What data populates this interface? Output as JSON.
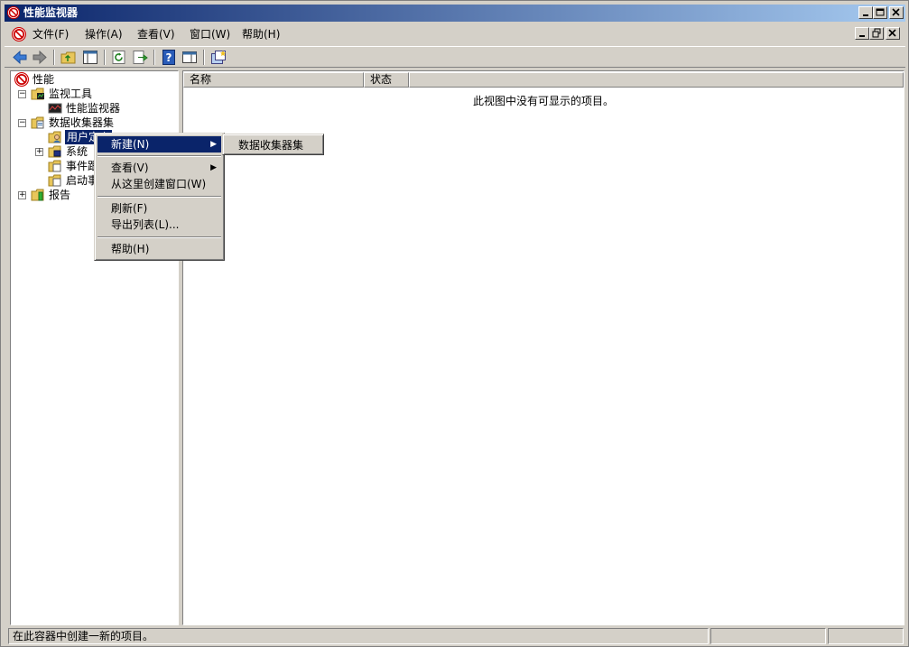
{
  "window": {
    "title": "性能监视器"
  },
  "menubar": {
    "items": [
      {
        "label": "文件(F)"
      },
      {
        "label": "操作(A)"
      },
      {
        "label": "查看(V)"
      },
      {
        "label": "窗口(W)"
      },
      {
        "label": "帮助(H)"
      }
    ]
  },
  "toolbar": {
    "buttons": [
      "back-icon",
      "forward-icon",
      "up-folder-icon",
      "show-hide-tree-icon",
      "refresh-icon",
      "export-list-icon",
      "help-icon",
      "show-hide-action-pane-icon",
      "new-window-icon"
    ]
  },
  "tree": {
    "root": "性能",
    "monitoring_tools": "监视工具",
    "perf_monitor": "性能监视器",
    "data_collector_sets": "数据收集器集",
    "user_defined": "用户定义",
    "system": "系统",
    "event_trace": "事件跟踪会话",
    "startup_event": "启动事件跟踪会话",
    "reports": "报告"
  },
  "list": {
    "columns": [
      "名称",
      "状态"
    ],
    "empty_message": "此视图中没有可显示的项目。"
  },
  "context_menu": {
    "new": "新建(N)",
    "view": "查看(V)",
    "new_window": "从这里创建窗口(W)",
    "refresh": "刷新(F)",
    "export": "导出列表(L)...",
    "help": "帮助(H)"
  },
  "submenu": {
    "data_collector_set": "数据收集器集"
  },
  "statusbar": {
    "text": "在此容器中创建一新的项目。"
  },
  "colors": {
    "title_gradient_start": "#0a246a",
    "title_gradient_end": "#a6caf0",
    "selection": "#0a246a",
    "face": "#d4d0c8"
  }
}
